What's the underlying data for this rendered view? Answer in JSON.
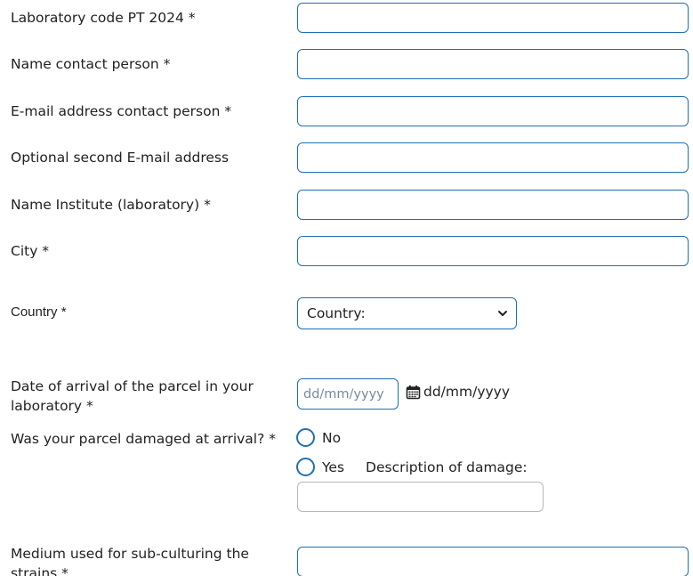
{
  "form": {
    "lab_code": {
      "label": "Laboratory code PT 2024 *",
      "value": ""
    },
    "contact_name": {
      "label": "Name contact person *",
      "value": ""
    },
    "contact_email": {
      "label": "E-mail address contact person *",
      "value": ""
    },
    "second_email": {
      "label": "Optional second E-mail address",
      "value": ""
    },
    "institute": {
      "label": "Name Institute (laboratory) *",
      "value": ""
    },
    "city": {
      "label": "City *",
      "value": ""
    },
    "country": {
      "label": "Country *",
      "selected": "Country:"
    },
    "arrival_date": {
      "label": "Date of arrival of the parcel in your laboratory *",
      "placeholder": "dd/mm/yyyy",
      "display": "dd/mm/yyyy",
      "icon": "calendar-icon"
    },
    "damaged": {
      "label": "Was your parcel damaged at arrival? *",
      "options": [
        "No",
        "Yes"
      ],
      "description_label": "Description of damage:",
      "description_value": ""
    },
    "medium": {
      "label": "Medium used for sub-culturing the strains *",
      "value": ""
    }
  },
  "colors": {
    "accent": "#1f6fb4",
    "text": "#222222",
    "placeholder": "#7a8a99",
    "neutral_border": "#b8b8b8"
  }
}
